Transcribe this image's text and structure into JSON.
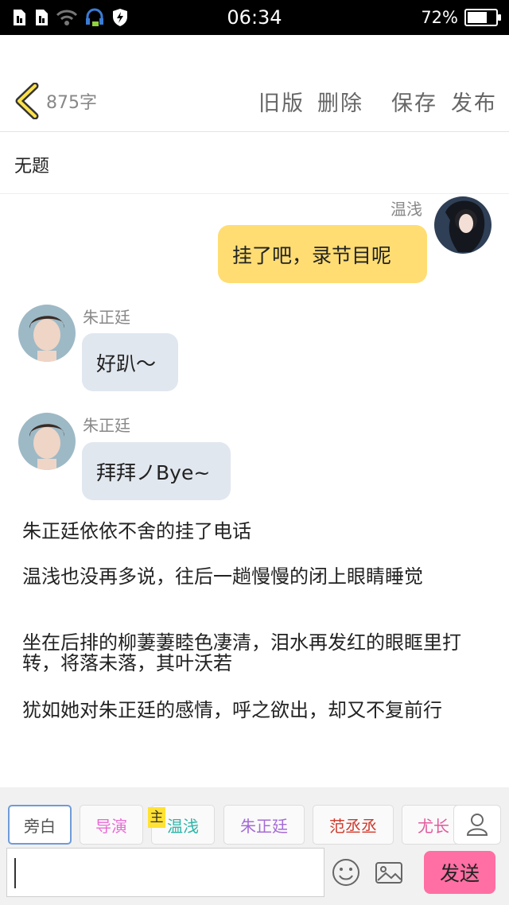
{
  "status_bar": {
    "time": "06:34",
    "battery_percent": "72%",
    "battery_level": 0.72
  },
  "header": {
    "word_count": "875字",
    "buttons": {
      "old_version": "旧版",
      "delete": "删除",
      "save": "保存",
      "publish": "发布"
    }
  },
  "doc": {
    "title": "无题"
  },
  "messages": [
    {
      "speaker": "温浅",
      "text": "挂了吧，录节目呢",
      "side": "right"
    },
    {
      "speaker": "朱正廷",
      "text": "好趴～",
      "side": "left"
    },
    {
      "speaker": "朱正廷",
      "text": "拜拜ノBye~",
      "side": "left"
    }
  ],
  "narration": [
    "朱正廷依依不舍的挂了电话",
    "温浅也没再多说，往后一趟慢慢的闭上眼睛睡觉",
    "坐在后排的柳萋萋睦色凄清，泪水再发红的眼眶里打转，将落未落，其叶沃若",
    "犹如她对朱正廷的感情，呼之欲出，却又不复前行"
  ],
  "characters": [
    {
      "label": "旁白",
      "color": "#555555",
      "selected": true
    },
    {
      "label": "导演",
      "color": "#e96bd6",
      "selected": false
    },
    {
      "label": "温浅",
      "color": "#2db5a8",
      "selected": false,
      "badge": "主"
    },
    {
      "label": "朱正廷",
      "color": "#a56bd6",
      "selected": false
    },
    {
      "label": "范丞丞",
      "color": "#d0392b",
      "selected": false
    },
    {
      "label": "尤长",
      "color": "#e25a9c",
      "selected": false
    }
  ],
  "input": {
    "value": ""
  },
  "send_label": "发送",
  "colors": {
    "accent_send": "#ff6fa3",
    "bubble_self": "#ffdd73",
    "bubble_other": "#e1e7ef"
  }
}
